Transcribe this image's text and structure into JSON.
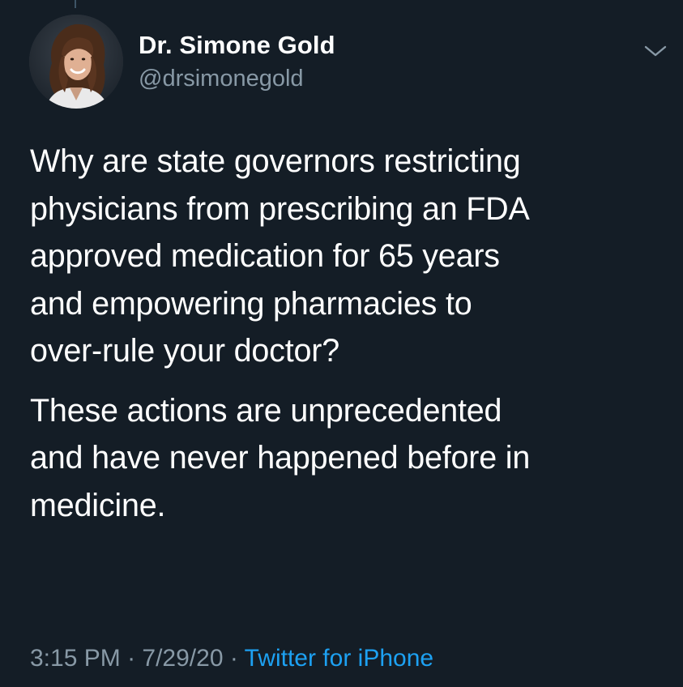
{
  "tweet": {
    "author": {
      "display_name": "Dr. Simone Gold",
      "handle": "@drsimonegold",
      "avatar_icon": "profile-photo"
    },
    "paragraphs": [
      "Why are state governors restricting\nphysicians from prescribing an FDA\napproved medication for 65 years\nand empowering pharmacies to\nover-rule your doctor?",
      "These actions are unprecedented\nand have never happened before in\nmedicine."
    ],
    "meta": {
      "time": "3:15 PM",
      "separator": " · ",
      "date": "7/29/20",
      "source": "Twitter for iPhone"
    },
    "menu_icon": "chevron-down-icon"
  },
  "colors": {
    "background": "#141d26",
    "primary_text": "#ffffff",
    "secondary_text": "#8899a6",
    "link": "#1da1f2"
  }
}
